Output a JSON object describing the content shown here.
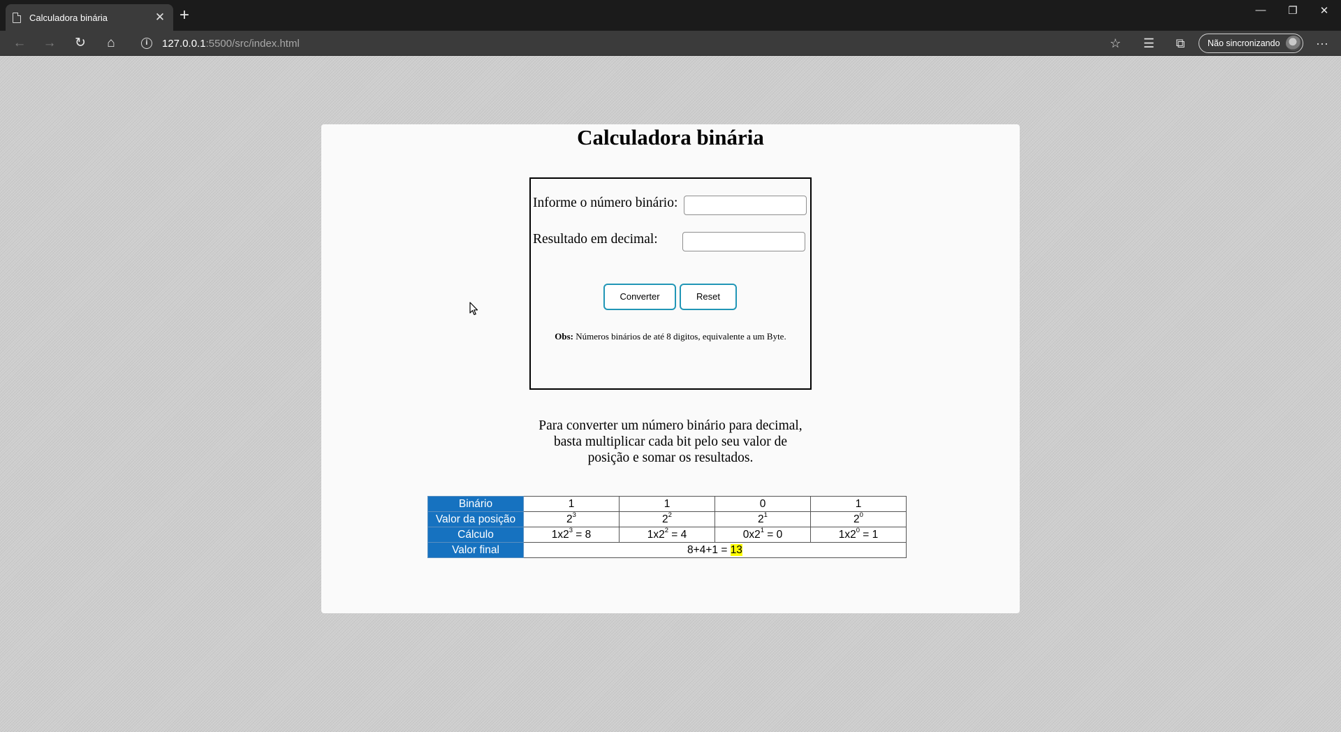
{
  "browser": {
    "tab_title": "Calculadora binária",
    "tab_close": "✕",
    "new_tab": "+",
    "url_host": "127.0.0.1",
    "url_path": ":5500/src/index.html",
    "profile_label": "Não sincronizando",
    "window_minimize": "—",
    "window_restore": "❐",
    "window_close": "✕",
    "more": "···"
  },
  "page": {
    "title": "Calculadora binária",
    "input_label": "Informe o número binário:",
    "input_value": "",
    "result_label": "Resultado em decimal:",
    "result_value": "",
    "convert_button": "Converter",
    "reset_button": "Reset",
    "obs_label": "Obs:",
    "obs_text": " Números binários de até 8 digitos, equivalente a um Byte.",
    "explanation_lines": [
      "Para converter um número binário para decimal,",
      "basta multiplicar cada bit pelo seu valor de",
      "posição e somar os resultados."
    ]
  },
  "table": {
    "headers": [
      "Binário",
      "Valor da posição",
      "Cálculo",
      "Valor final"
    ],
    "bits": [
      "1",
      "1",
      "0",
      "1"
    ],
    "position_base": [
      "2",
      "2",
      "2",
      "2"
    ],
    "position_exp": [
      "3",
      "2",
      "1",
      "0"
    ],
    "calc_prefix": [
      "1x2",
      "1x2",
      "0x2",
      "1x2"
    ],
    "calc_exp": [
      "3",
      "2",
      "1",
      "0"
    ],
    "calc_result": [
      " = 8",
      " = 4",
      " = 0",
      " = 1"
    ],
    "final_expression": "8+4+1 = ",
    "final_value": "13"
  },
  "colors": {
    "table_header": "#1672c0",
    "button_border": "#2196b6",
    "highlight": "#ffff00"
  }
}
